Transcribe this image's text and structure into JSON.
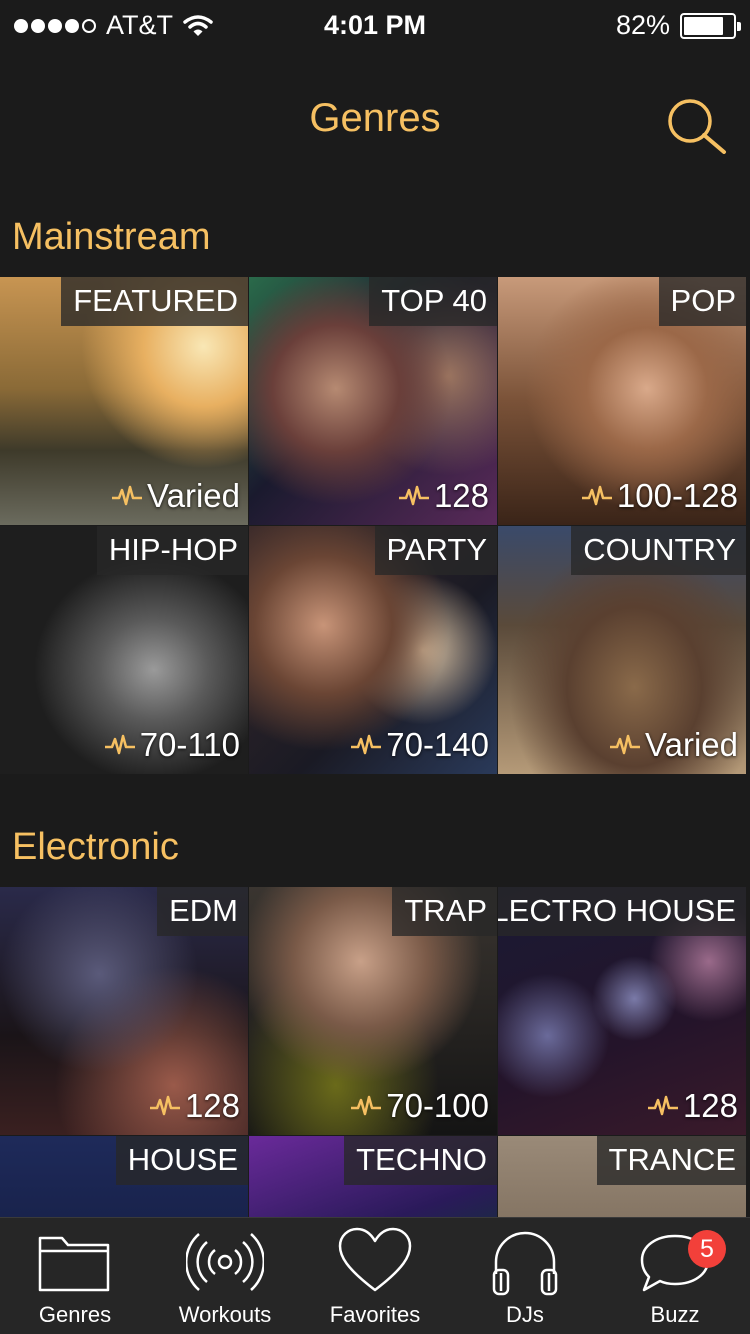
{
  "status_bar": {
    "carrier": "AT&T",
    "time": "4:01 PM",
    "battery_percent": "82%",
    "battery_level": 0.82,
    "signal_bars": 4,
    "signal_max": 5
  },
  "nav": {
    "title": "Genres",
    "search_icon": "search-icon"
  },
  "accent_color": "#f6c062",
  "sections": [
    {
      "title": "Mainstream",
      "tiles": [
        {
          "name": "FEATURED",
          "bpm": "Varied"
        },
        {
          "name": "TOP 40",
          "bpm": "128"
        },
        {
          "name": "POP",
          "bpm": "100-128"
        },
        {
          "name": "HIP-HOP",
          "bpm": "70-110"
        },
        {
          "name": "PARTY",
          "bpm": "70-140"
        },
        {
          "name": "COUNTRY",
          "bpm": "Varied"
        }
      ]
    },
    {
      "title": "Electronic",
      "tiles": [
        {
          "name": "EDM",
          "bpm": "128"
        },
        {
          "name": "TRAP",
          "bpm": "70-100"
        },
        {
          "name": "ELECTRO HOUSE",
          "bpm": "128"
        },
        {
          "name": "HOUSE",
          "bpm": ""
        },
        {
          "name": "TECHNO",
          "bpm": ""
        },
        {
          "name": "TRANCE",
          "bpm": ""
        }
      ]
    }
  ],
  "tab_bar": {
    "tabs": [
      {
        "label": "Genres",
        "icon": "folder-icon"
      },
      {
        "label": "Workouts",
        "icon": "broadcast-icon"
      },
      {
        "label": "Favorites",
        "icon": "heart-icon"
      },
      {
        "label": "DJs",
        "icon": "headphones-icon"
      },
      {
        "label": "Buzz",
        "icon": "chat-bubble-icon",
        "badge": "5"
      }
    ]
  }
}
